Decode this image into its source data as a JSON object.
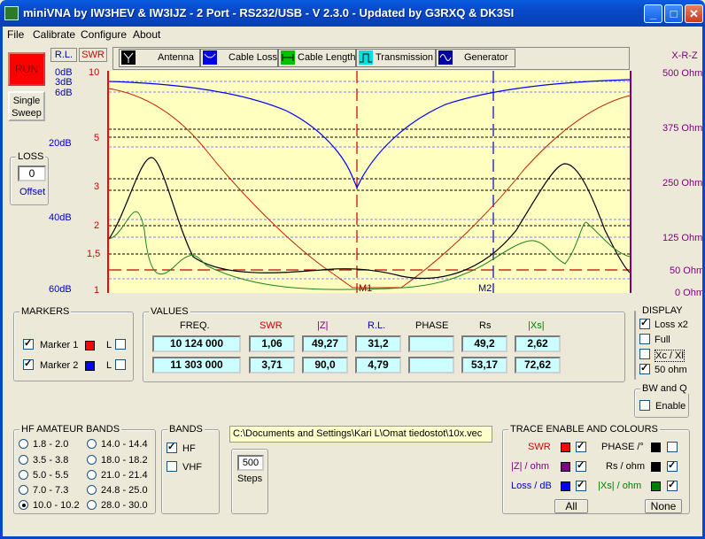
{
  "window": {
    "title": "miniVNA by IW3HEV & IW3IJZ - 2 Port - RS232/USB - V 2.3.0 - Updated by G3RXQ & DK3SI"
  },
  "menu": [
    "File",
    "Calibrate",
    "Configure",
    "About"
  ],
  "buttons": {
    "run": "RUN",
    "single_sweep": "Single Sweep",
    "all": "All",
    "none": "None"
  },
  "loss": {
    "title": "LOSS",
    "value": "0",
    "offset_label": "Offset"
  },
  "tabs": {
    "rl": "R.L.",
    "swr": "SWR",
    "xrz": "X-R-Z"
  },
  "toolbar": [
    {
      "label": "Antenna",
      "icon": "antenna-icon"
    },
    {
      "label": "Cable Loss",
      "icon": "cable-loss-icon"
    },
    {
      "label": "Cable Length",
      "icon": "cable-length-icon"
    },
    {
      "label": "Transmission",
      "icon": "transmission-icon"
    },
    {
      "label": "Generator",
      "icon": "generator-icon"
    }
  ],
  "axes": {
    "rl_ticks": [
      "0dB",
      "3dB",
      "6dB",
      "20dB",
      "40dB",
      "60dB"
    ],
    "swr_ticks": [
      "10",
      "5",
      "3",
      "2",
      "1,5",
      "1"
    ],
    "ohm_ticks": [
      "500 Ohm",
      "375 Ohm",
      "250 Ohm",
      "125 Ohm",
      "50 Ohm",
      "0 Ohm"
    ]
  },
  "chart": {
    "marker1_label": "M1",
    "marker2_label": "M2"
  },
  "markers": {
    "title": "MARKERS",
    "items": [
      {
        "label": "Marker 1",
        "checked": true,
        "color": "#ff0000",
        "l_label": "L"
      },
      {
        "label": "Marker 2",
        "checked": true,
        "color": "#0000ff",
        "l_label": "L"
      }
    ]
  },
  "values": {
    "title": "VALUES",
    "headers": [
      "FREQ.",
      "SWR",
      "|Z|",
      "R.L.",
      "PHASE",
      "Rs",
      "|Xs|"
    ],
    "rows": [
      [
        "10 124 000",
        "1,06",
        "49,27",
        "31,2",
        "",
        "49,2",
        "2,62"
      ],
      [
        "11 303 000",
        "3,71",
        "90,0",
        "4,79",
        "",
        "53,17",
        "72,62"
      ]
    ]
  },
  "display": {
    "title": "DISPLAY",
    "items": [
      {
        "label": "Loss x2",
        "checked": true
      },
      {
        "label": "Full",
        "checked": false
      },
      {
        "label": "Xc / Xl",
        "checked": false
      },
      {
        "label": "50 ohm",
        "checked": true
      }
    ]
  },
  "bwq": {
    "title": "BW and Q",
    "enable_label": "Enable",
    "checked": false
  },
  "hf_bands": {
    "title": "HF AMATEUR BANDS",
    "items": [
      "1.8 - 2.0",
      "14.0 - 14.4",
      "3.5 - 3.8",
      "18.0 - 18.2",
      "5.0 - 5.5",
      "21.0 - 21.4",
      "7.0 - 7.3",
      "24.8 - 25.0",
      "10.0 - 10.2",
      "28.0 - 30.0"
    ],
    "selected": "10.0 - 10.2"
  },
  "bands": {
    "title": "BANDS",
    "hf": "HF",
    "vhf": "VHF",
    "hf_checked": true,
    "vhf_checked": false
  },
  "file_path": "C:\\Documents and Settings\\Kari L\\Omat tiedostot\\10x.vec",
  "steps": {
    "value": "500",
    "label": "Steps"
  },
  "trace": {
    "title": "TRACE ENABLE AND COLOURS",
    "items": [
      {
        "label": "SWR",
        "color": "#ff0000",
        "text_color": "#d00000",
        "checked": true
      },
      {
        "label": "PHASE /°",
        "color": "#000000",
        "text_color": "#000000",
        "checked": false
      },
      {
        "label": "|Z| / ohm",
        "color": "#800080",
        "text_color": "#800080",
        "checked": true
      },
      {
        "label": "Rs / ohm",
        "color": "#000000",
        "text_color": "#000000",
        "checked": true
      },
      {
        "label": "Loss / dB",
        "color": "#0000ff",
        "text_color": "#0000c0",
        "checked": true
      },
      {
        "label": "|Xs| / ohm",
        "color": "#008000",
        "text_color": "#008000",
        "checked": true
      }
    ]
  }
}
